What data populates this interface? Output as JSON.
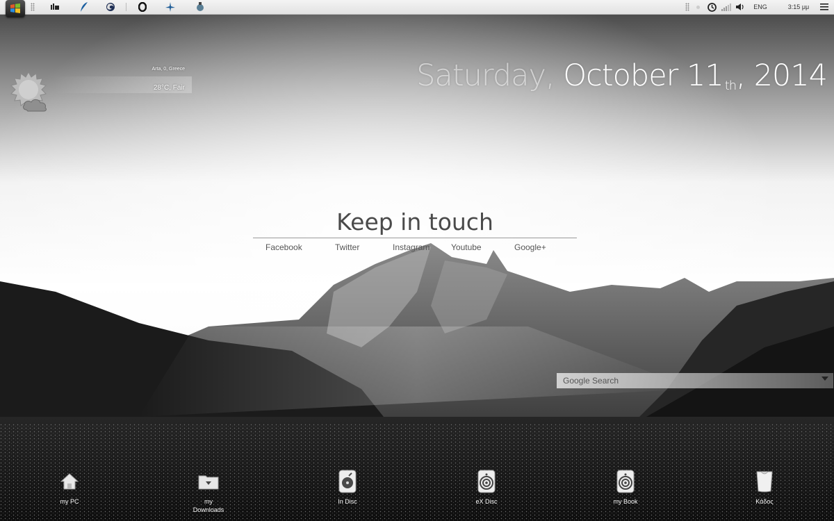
{
  "topbar": {
    "left_icons": [
      "windows-start-icon",
      "grip-icon",
      "library-icon",
      "feather-icon",
      "firefox-icon",
      "opera-icon",
      "bird-icon",
      "network-globe-icon"
    ],
    "right": {
      "language": "ENG",
      "time": "3:15 μμ"
    }
  },
  "weather": {
    "location": "Arta, 0, Greece",
    "conditions": "28°C, Fair",
    "icon": "sun-cloud-icon"
  },
  "date": {
    "day": "Saturday,",
    "month": "October",
    "day_number": "11",
    "suffix": "th",
    "comma": ",",
    "year": "2014"
  },
  "social": {
    "title": "Keep in touch",
    "links": [
      "Facebook",
      "Twitter",
      "Instagram",
      "Youtube",
      "Google+"
    ]
  },
  "search": {
    "placeholder": "Google Search"
  },
  "dock": [
    {
      "label": "my PC",
      "icon": "house-icon"
    },
    {
      "label": "my\nDownloads",
      "icon": "downloads-folder-icon"
    },
    {
      "label": "In Disc",
      "icon": "internal-disk-icon"
    },
    {
      "label": "eX Disc",
      "icon": "external-disk-icon"
    },
    {
      "label": "my Book",
      "icon": "book-drive-icon"
    },
    {
      "label": "Κάδος",
      "icon": "trash-bin-icon"
    }
  ],
  "colors": {
    "topbar": "#ececec",
    "accent_text": "#ffffff",
    "title_text": "#4a4a4a"
  }
}
